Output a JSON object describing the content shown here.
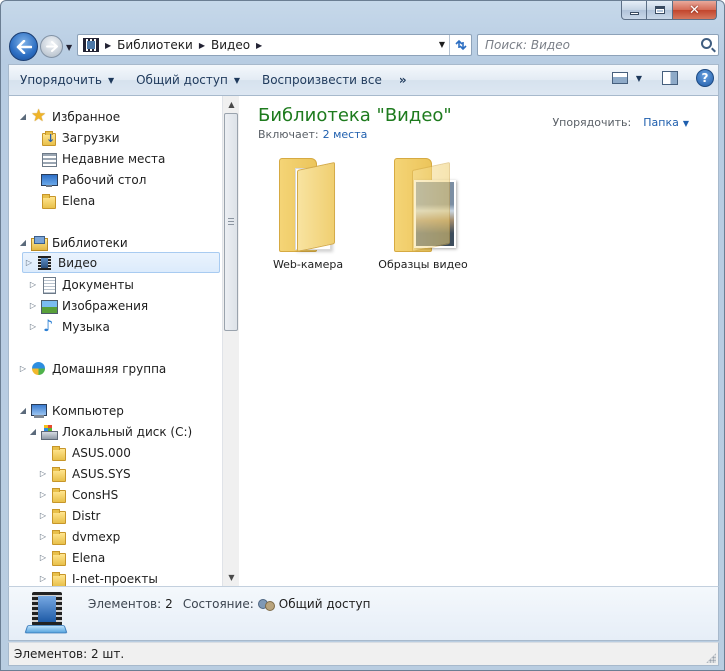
{
  "address": {
    "crumbs": [
      "Библиотеки",
      "Видео"
    ]
  },
  "search": {
    "placeholder": "Поиск: Видео"
  },
  "toolbar": {
    "arrange_label": "Упорядочить",
    "share_label": "Общий доступ",
    "play_label": "Воспроизвести все",
    "more_label": "»"
  },
  "nav": {
    "favorites": "Избранное",
    "downloads": "Загрузки",
    "recent": "Недавние места",
    "desktop": "Рабочий стол",
    "elena_fav": "Elena",
    "libraries": "Библиотеки",
    "video": "Видео",
    "documents": "Документы",
    "images": "Изображения",
    "music": "Музыка",
    "homegroup": "Домашняя группа",
    "computer": "Компьютер",
    "localdisk": "Локальный диск (C:)",
    "folders": [
      "ASUS.000",
      "ASUS.SYS",
      "ConsHS",
      "Distr",
      "dvmexp",
      "Elena",
      "I-net-проекты"
    ]
  },
  "main": {
    "title": "Библиотека \"Видео\"",
    "includes_label": "Включает:",
    "includes_link": "2 места",
    "arrange_label": "Упорядочить:",
    "arrange_value": "Папка",
    "items": [
      "Web-камера",
      "Образцы видео"
    ]
  },
  "details": {
    "count_label": "Элементов:",
    "count_value": "2",
    "state_label": "Состояние:",
    "state_value": "Общий доступ"
  },
  "status": {
    "text": "Элементов: 2 шт."
  },
  "colors": {
    "library_title": "#1e7b1e",
    "link": "#1f5fae",
    "selection": "#dcebfc"
  }
}
